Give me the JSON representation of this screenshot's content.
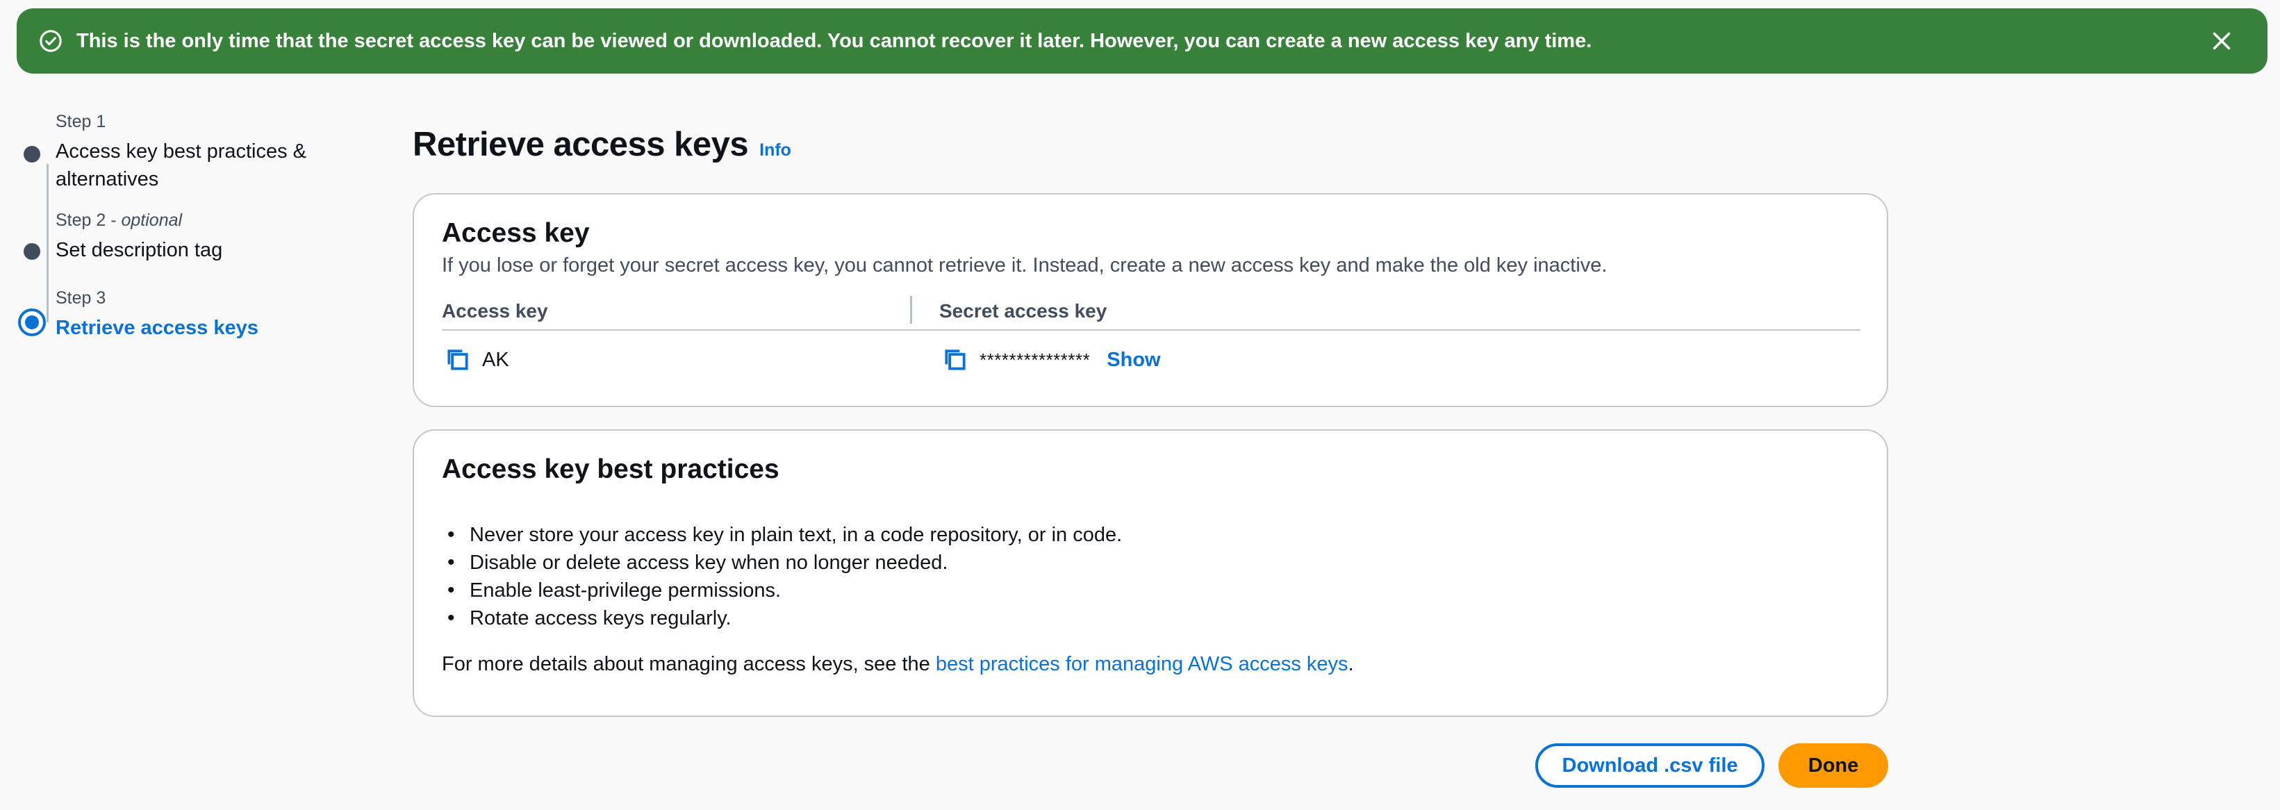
{
  "flash": {
    "message": "This is the only time that the secret access key can be viewed or downloaded. You cannot recover it later. However, you can create a new access key any time.",
    "color": "#37813a"
  },
  "stepper": {
    "steps": [
      {
        "number": "Step 1",
        "optional": "",
        "title": "Access key best practices &",
        "title_line2": "alternatives",
        "state": "complete"
      },
      {
        "number": "Step 2",
        "optional": "optional",
        "title": "Set description tag",
        "state": "complete"
      },
      {
        "number": "Step 3",
        "optional": "",
        "title": "Retrieve access keys",
        "state": "active"
      }
    ]
  },
  "page": {
    "title": "Retrieve access keys",
    "info_link": "Info"
  },
  "access_key_card": {
    "heading": "Access key",
    "description": "If you lose or forget your secret access key, you cannot retrieve it. Instead, create a new access key and make the old key inactive.",
    "col_access_key": "Access key",
    "col_secret_key": "Secret access key",
    "access_key_value": "AK",
    "secret_masked": "***************",
    "show_label": "Show"
  },
  "best_practices_card": {
    "heading": "Access key best practices",
    "items": [
      "Never store your access key in plain text, in a code repository, or in code.",
      "Disable or delete access key when no longer needed.",
      "Enable least-privilege permissions.",
      "Rotate access keys regularly."
    ],
    "footer_prefix": "For more details about managing access keys, see the ",
    "footer_link": "best practices for managing AWS access keys",
    "footer_suffix": "."
  },
  "actions": {
    "download_label": "Download .csv file",
    "done_label": "Done"
  },
  "colors": {
    "accent": "#0972d3",
    "primary_button": "#ff9900",
    "success": "#37813a"
  }
}
